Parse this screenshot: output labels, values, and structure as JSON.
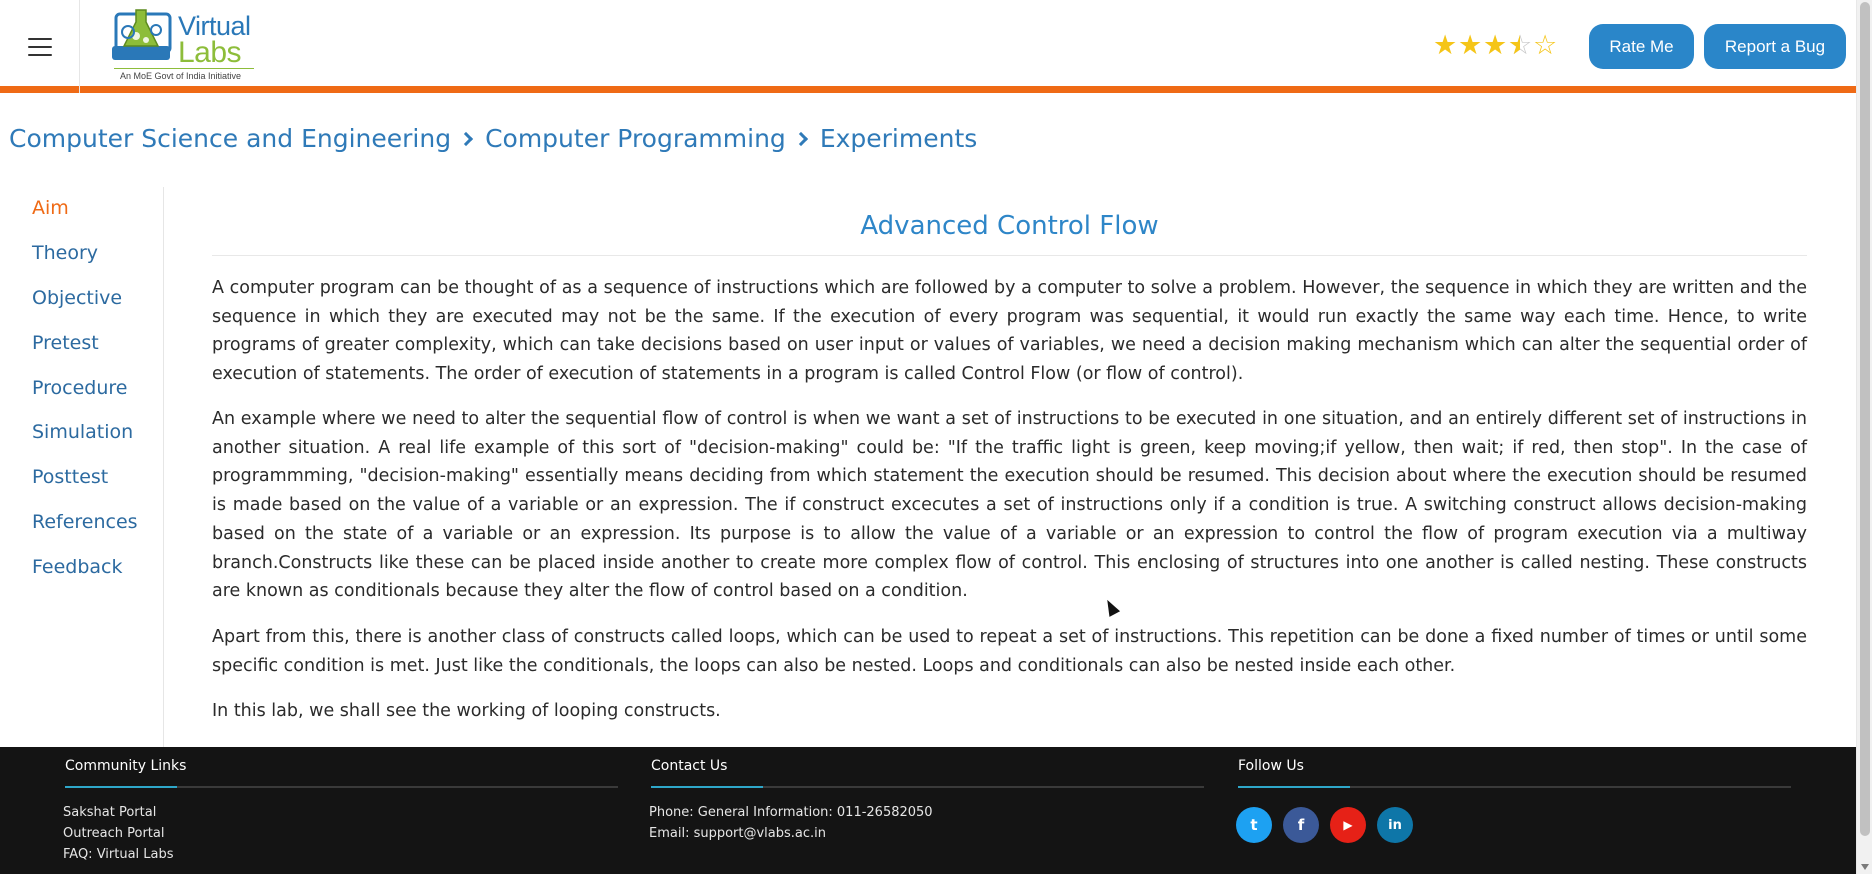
{
  "header": {
    "logo_main": "Virtual",
    "logo_sub": "Labs",
    "logo_tagline": "An MoE Govt of India Initiative",
    "rating": 3.5,
    "rating_max": 5,
    "rate_button": "Rate Me",
    "bug_button": "Report a Bug",
    "accent_color": "#ef6a15",
    "button_color": "#2a86c9"
  },
  "breadcrumb": [
    "Computer Science and Engineering",
    "Computer Programming",
    "Experiments"
  ],
  "sidebar": {
    "active": "Aim",
    "items": [
      "Aim",
      "Theory",
      "Objective",
      "Pretest",
      "Procedure",
      "Simulation",
      "Posttest",
      "References",
      "Feedback"
    ]
  },
  "content": {
    "title": "Advanced Control Flow",
    "paragraphs": [
      "A computer program can be thought of as a sequence of instructions which are followed by a computer to solve a problem. However, the sequence in which they are written and the sequence in which they are executed may not be the same. If the execution of every program was sequential, it would run exactly the same way each time. Hence, to write programs of greater complexity, which can take decisions based on user input or values of variables, we need a decision making mechanism which can alter the sequential order of execution of statements. The order of execution of statements in a program is called Control Flow (or flow of control).",
      "An example where we need to alter the sequential flow of control is when we want a set of instructions to be executed in one situation, and an entirely different set of instructions in another situation. A real life example of this sort of \"decision-making\" could be: \"If the traffic light is green, keep moving;if yellow, then wait; if red, then stop\". In the case of programmming, \"decision-making\" essentially means deciding from which statement the execution should be resumed. This decision about where the execution should be resumed is made based on the value of a variable or an expression. The if construct excecutes a set of instructions only if a condition is true. A switching construct allows decision-making based on the state of a variable or an expression. Its purpose is to allow the value of a variable or an expression to control the flow of program execution via a multiway branch.Constructs like these can be placed inside another to create more complex flow of control. This enclosing of structures into one another is called nesting. These constructs are known as conditionals because they alter the flow of control based on a condition.",
      "Apart from this, there is another class of constructs called loops, which can be used to repeat a set of instructions. This repetition can be done a fixed number of times or until some specific condition is met. Just like the conditionals, the loops can also be nested. Loops and conditionals can also be nested inside each other.",
      "In this lab, we shall see the working of looping constructs."
    ]
  },
  "footer": {
    "community": {
      "heading": "Community Links",
      "links": [
        "Sakshat Portal",
        "Outreach Portal",
        "FAQ: Virtual Labs"
      ]
    },
    "contact": {
      "heading": "Contact Us",
      "phone": "Phone: General Information: 011-26582050",
      "email": "Email: support@vlabs.ac.in"
    },
    "follow": {
      "heading": "Follow Us",
      "icons": [
        {
          "name": "twitter-icon",
          "glyph": "t",
          "color": "#1da1f2"
        },
        {
          "name": "facebook-icon",
          "glyph": "f",
          "color": "#3b5998"
        },
        {
          "name": "youtube-icon",
          "glyph": "▶",
          "color": "#e62117"
        },
        {
          "name": "linkedin-icon",
          "glyph": "in",
          "color": "#0e76a8"
        }
      ]
    }
  }
}
